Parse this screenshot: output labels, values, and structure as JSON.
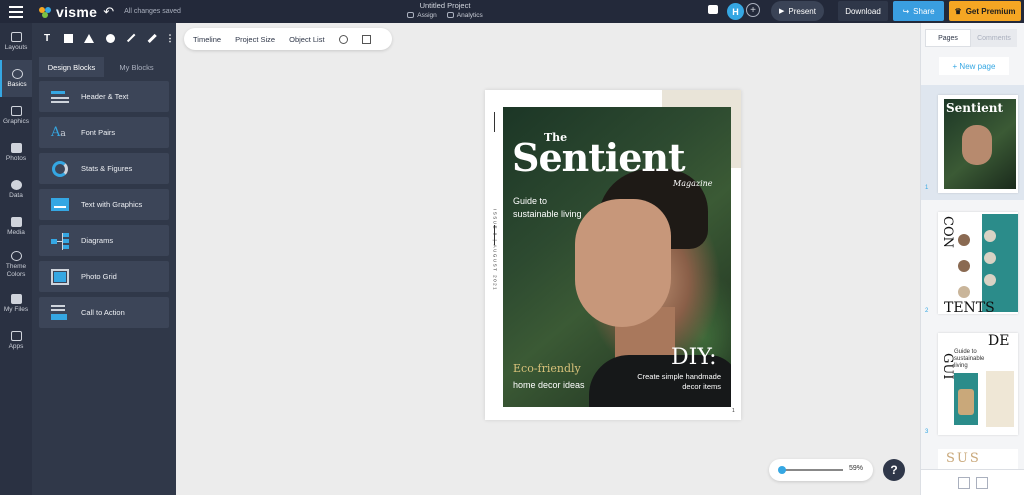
{
  "app": {
    "name": "visme",
    "save_status": "All changes saved"
  },
  "project": {
    "title": "Untitled Project",
    "assign_label": "Assign",
    "analytics_label": "Analytics"
  },
  "header": {
    "avatar_initial": "H",
    "present_label": "Present",
    "download_label": "Download",
    "share_label": "Share",
    "premium_label": "Get Premium"
  },
  "rail": {
    "items": [
      {
        "label": "Layouts",
        "icon": "layouts-icon"
      },
      {
        "label": "Basics",
        "icon": "basics-icon"
      },
      {
        "label": "Graphics",
        "icon": "graphics-icon"
      },
      {
        "label": "Photos",
        "icon": "photos-icon"
      },
      {
        "label": "Data",
        "icon": "data-icon"
      },
      {
        "label": "Media",
        "icon": "media-icon"
      },
      {
        "label": "Theme Colors",
        "icon": "palette-icon"
      },
      {
        "label": "My Files",
        "icon": "folder-icon"
      },
      {
        "label": "Apps",
        "icon": "apps-icon"
      }
    ],
    "active": "Basics"
  },
  "panel": {
    "tabs": [
      "Design Blocks",
      "My Blocks"
    ],
    "active_tab": "Design Blocks",
    "blocks": [
      {
        "label": "Header & Text",
        "icon": "header-text-icon"
      },
      {
        "label": "Font Pairs",
        "icon": "font-pairs-icon"
      },
      {
        "label": "Stats & Figures",
        "icon": "stats-icon"
      },
      {
        "label": "Text with Graphics",
        "icon": "text-graphics-icon"
      },
      {
        "label": "Diagrams",
        "icon": "diagram-icon"
      },
      {
        "label": "Photo Grid",
        "icon": "photo-grid-icon"
      },
      {
        "label": "Call to Action",
        "icon": "call-to-action-icon"
      }
    ]
  },
  "canvas_tools": {
    "timeline": "Timeline",
    "project_size": "Project Size",
    "object_list": "Object List"
  },
  "cover": {
    "the": "The",
    "title": "Sentient",
    "subtitle": "Magazine",
    "tagline": "Guide to sustainable living",
    "eco": "Eco-friendly",
    "eco_sub": "home decor ideas",
    "diy": "DIY:",
    "diy_sub": "Create simple handmade decor items",
    "spine": "ISSUE 9 | AUGUST 2021",
    "page_number": "1"
  },
  "zoom": {
    "value": "59%",
    "level": 0.05
  },
  "help_label": "?",
  "pages_panel": {
    "tabs": [
      "Pages",
      "Comments"
    ],
    "active_tab": "Pages",
    "new_page_label": "+ New page",
    "pages": [
      {
        "number": "1"
      },
      {
        "number": "2"
      },
      {
        "number": "3"
      }
    ],
    "thumb1_title": "Sentient",
    "thumb3_text": "Guide to sustainable living"
  },
  "colors": {
    "accent": "#35a7e3",
    "premium": "#f5a623",
    "dark_bg": "#23293a",
    "panel_bg": "#303849"
  }
}
